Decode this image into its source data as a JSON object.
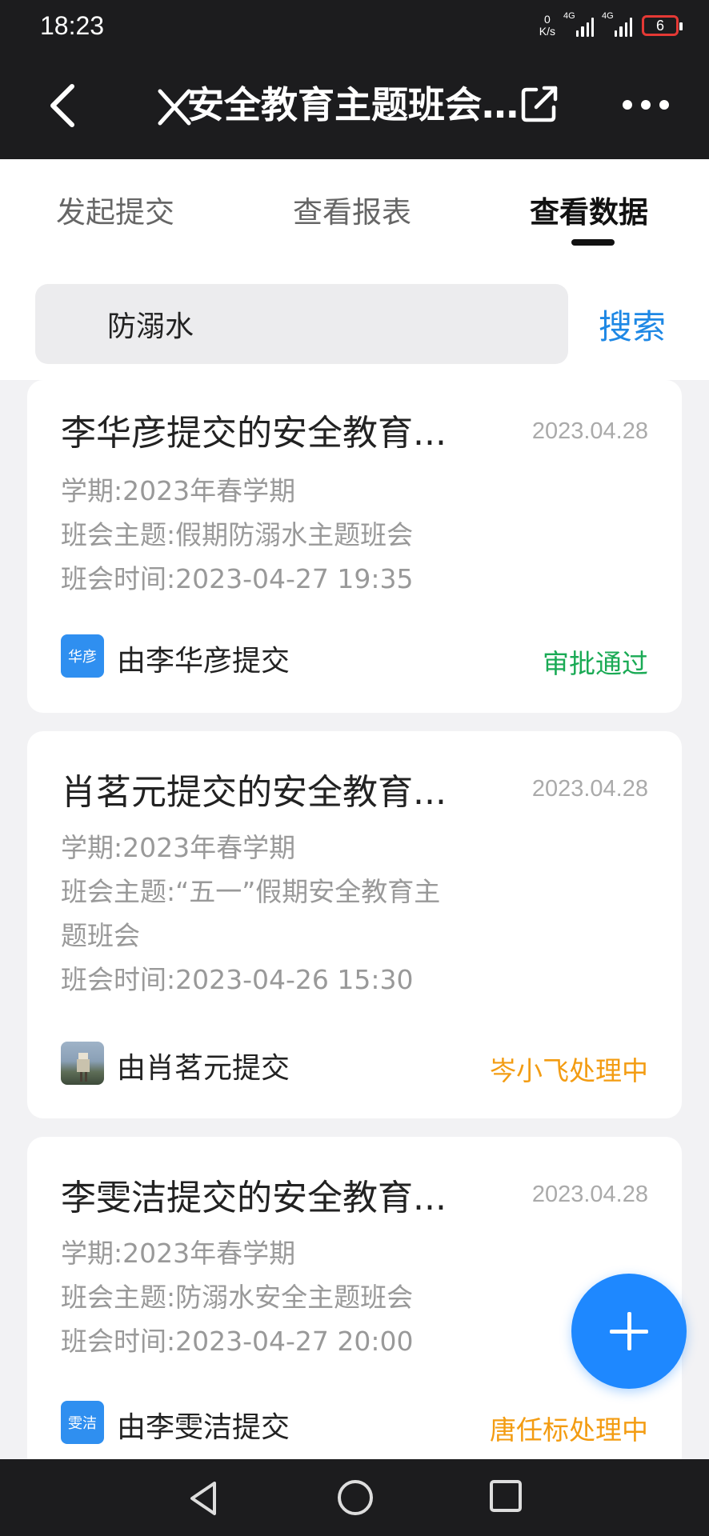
{
  "status_bar": {
    "time": "18:23",
    "net_speed_value": "0",
    "net_speed_unit": "K/s",
    "sim1_label": "4G",
    "sim2_label": "4G",
    "battery": "6"
  },
  "header": {
    "title": "安全教育主题班会..."
  },
  "tabs": [
    {
      "label": "发起提交"
    },
    {
      "label": "查看报表"
    },
    {
      "label": "查看数据"
    }
  ],
  "search": {
    "value": "防溺水",
    "button_label": "搜索"
  },
  "cards": [
    {
      "title": "李华彦提交的安全教育...",
      "date": "2023.04.28",
      "term": "学期:2023年春学期",
      "topic_line1": "班会主题:假期防溺水主题班会",
      "topic_line2": "",
      "time": "班会时间:2023-04-27 19:35",
      "avatar_text": "华彦",
      "submitter": "由李华彦提交",
      "status": "审批通过"
    },
    {
      "title": "肖茗元提交的安全教育...",
      "date": "2023.04.28",
      "term": "学期:2023年春学期",
      "topic_line1": "班会主题:“五一”假期安全教育主",
      "topic_line2": "题班会",
      "time": "班会时间:2023-04-26 15:30",
      "avatar_text": "",
      "submitter": "由肖茗元提交",
      "status": "岑小飞处理中"
    },
    {
      "title": "李雯洁提交的安全教育...",
      "date": "2023.04.28",
      "term": "学期:2023年春学期",
      "topic_line1": "班会主题:防溺水安全主题班会",
      "topic_line2": "",
      "time": "班会时间:2023-04-27 20:00",
      "avatar_text": "雯洁",
      "submitter": "由李雯洁提交",
      "status": "唐任标处理中"
    }
  ],
  "colors": {
    "accent": "#1e88e5",
    "approved": "#1aaa55",
    "pending": "#f39c12",
    "dark_bar": "#1c1c1e"
  },
  "icons": {
    "back": "back-arrow-icon",
    "close": "close-icon",
    "share": "share-icon",
    "more": "more-icon",
    "fab": "plus-icon"
  }
}
